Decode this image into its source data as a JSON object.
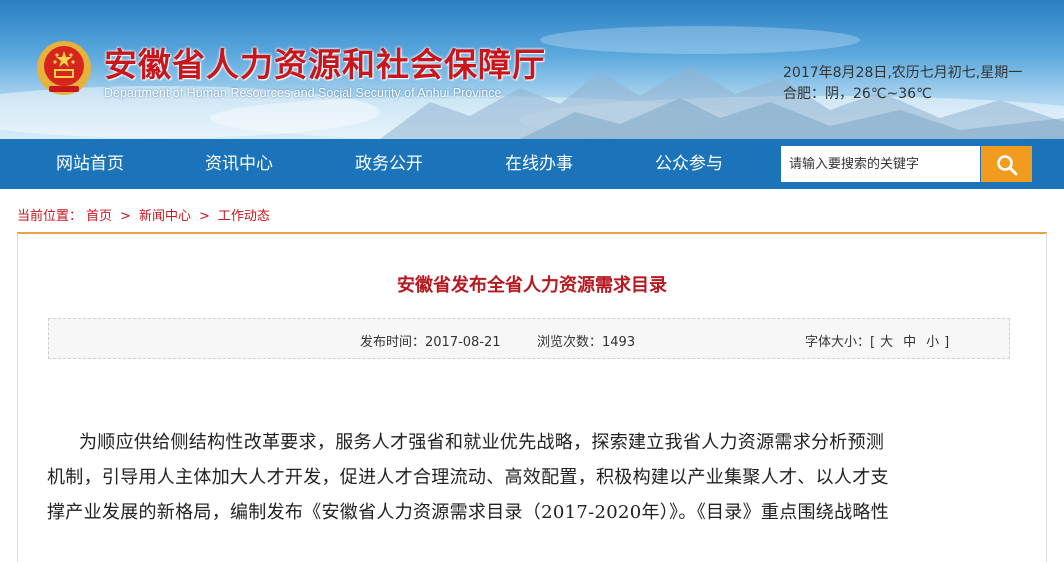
{
  "header": {
    "title": "安徽省人力资源和社会保障厅",
    "subtitle": "Department of Human Resources and Social Security of Anhui Province",
    "date_line": "2017年8月28日,农历七月初七,星期一",
    "weather_line": "合肥：阴，26℃~36℃"
  },
  "nav": {
    "items": [
      {
        "label": "网站首页"
      },
      {
        "label": "资讯中心"
      },
      {
        "label": "政务公开"
      },
      {
        "label": "在线办事"
      },
      {
        "label": "公众参与"
      }
    ],
    "search_placeholder": "请输入要搜索的关键字",
    "search_icon": "search-icon"
  },
  "breadcrumb": {
    "prefix": "当前位置：",
    "items": [
      "首页",
      "新闻中心",
      "工作动态"
    ],
    "separator": ">"
  },
  "article": {
    "title": "安徽省发布全省人力资源需求目录",
    "publish_label": "发布时间：2017-08-21",
    "views_label": "浏览次数：1493",
    "font_size_label": "字体大小：[",
    "font_sizes": [
      "大",
      "中",
      "小"
    ],
    "font_size_close": "]",
    "body_lines": [
      "为顺应供给侧结构性改革要求，服务人才强省和就业优先战略，探索建立我省人力资源需求分析预测",
      "机制，引导用人主体加大人才开发，促进人才合理流动、高效配置，积极构建以产业集聚人才、以人才支",
      "撑产业发展的新格局，编制发布《安徽省人力资源需求目录（2017-2020年）》。《目录》重点围绕战略性"
    ]
  },
  "colors": {
    "nav_bg": "#1b73b9",
    "accent_red": "#c8161d",
    "search_button": "#f29c1f",
    "panel_top_border": "#f0a040"
  }
}
